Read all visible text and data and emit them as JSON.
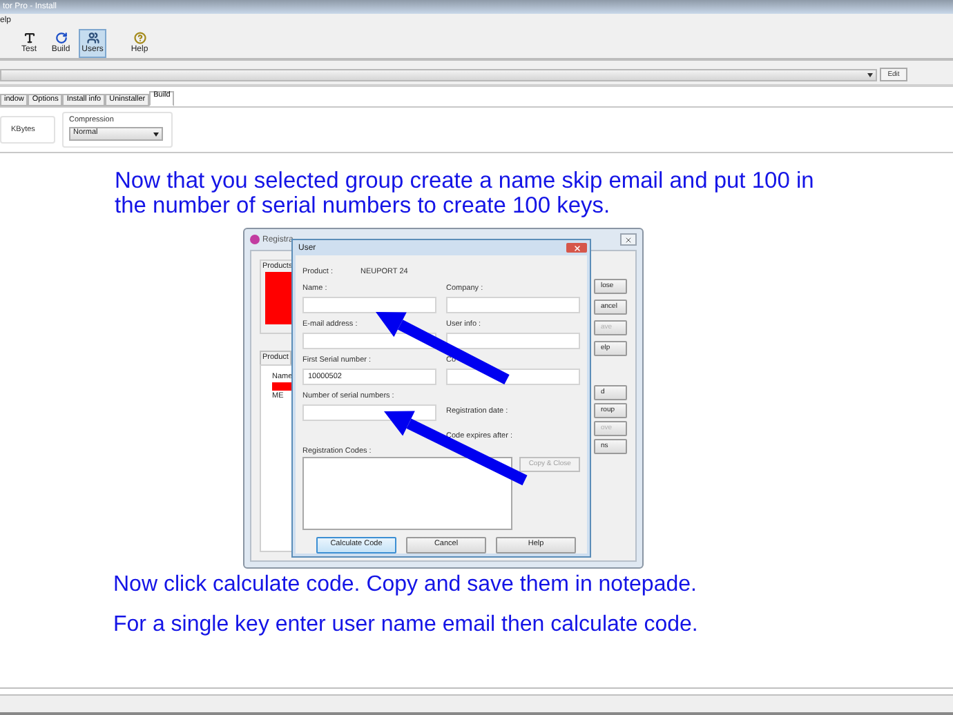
{
  "window": {
    "title": "tor Pro - Install"
  },
  "menu": [
    "elp"
  ],
  "toolbar": [
    {
      "label": "Test",
      "selected": false
    },
    {
      "label": "Build",
      "selected": false
    },
    {
      "label": "Users",
      "selected": true
    },
    {
      "label": "Help",
      "selected": false
    }
  ],
  "project_bar": {
    "button": "Edit"
  },
  "tabs": [
    {
      "label": "indow",
      "selected": false
    },
    {
      "label": "Options",
      "selected": false
    },
    {
      "label": "Install info",
      "selected": false
    },
    {
      "label": "Uninstaller",
      "selected": false
    },
    {
      "label": "Build",
      "selected": true
    }
  ],
  "build_panel": {
    "size_unit": "KBytes",
    "compression_label": "Compression",
    "compression_value": "Normal"
  },
  "instructions": [
    "Now that you selected group create a name skip email and put 100 in the number of serial numbers to create 100 keys.",
    "Now click calculate code. Copy and save them in notepade.",
    "For a single key enter user name email then calculate code."
  ],
  "registration_dialog": {
    "title": "Registra",
    "products_label": "Products",
    "product_section_label": "Product",
    "list_header": "Name",
    "list_items": [
      "ME"
    ],
    "side_buttons": [
      {
        "label": "lose",
        "disabled": false
      },
      {
        "label": "ancel",
        "disabled": false
      },
      {
        "label": "ave",
        "disabled": true
      },
      {
        "label": "elp",
        "disabled": false
      }
    ],
    "group_buttons": [
      {
        "label": "d",
        "disabled": false
      },
      {
        "label": "roup",
        "disabled": false
      },
      {
        "label": "ove",
        "disabled": true
      },
      {
        "label": "ns",
        "disabled": false
      }
    ]
  },
  "user_dialog": {
    "title": "User",
    "product_label": "Product :",
    "product_value": "NEUPORT 24",
    "left_fields": [
      {
        "kind": "input",
        "label": "Name :"
      },
      {
        "kind": "input",
        "label": "E-mail address :"
      },
      {
        "kind": "input",
        "label": "First Serial number :",
        "value": "10000502"
      },
      {
        "kind": "input",
        "label": "Number of serial numbers :"
      }
    ],
    "right_fields": [
      {
        "kind": "input",
        "label": "Company :"
      },
      {
        "kind": "input",
        "label": "User info :"
      },
      {
        "kind": "input",
        "label": "Co"
      },
      {
        "kind": "label",
        "label": "Registration date :"
      },
      {
        "kind": "label",
        "label": "Code expires after :"
      }
    ],
    "codes_label": "Registration Codes :",
    "copy_button": {
      "label": "Copy & Close",
      "disabled": true
    },
    "buttons": [
      {
        "label": "Calculate Code",
        "selected": true
      },
      {
        "label": "Cancel",
        "selected": false
      },
      {
        "label": "Help",
        "selected": false
      }
    ]
  }
}
